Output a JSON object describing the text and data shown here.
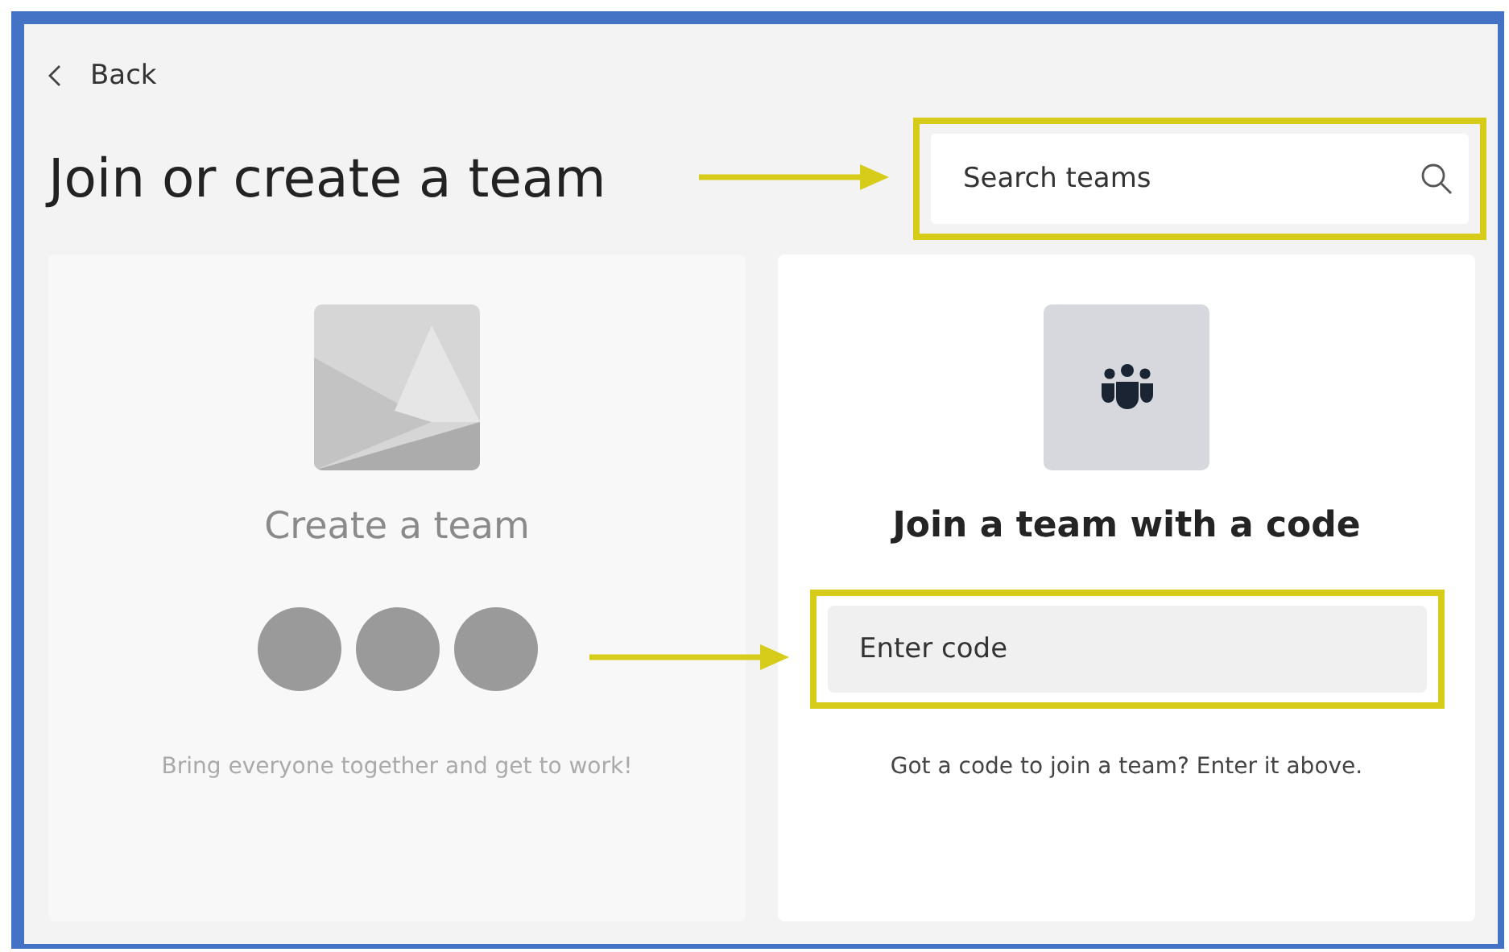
{
  "back": {
    "label": "Back"
  },
  "title": "Join or create a team",
  "search": {
    "placeholder": "Search teams"
  },
  "cards": [
    {
      "kind": "create",
      "title": "Create a team",
      "disabled": true,
      "description": "Bring everyone together and get to work!"
    },
    {
      "kind": "join",
      "title": "Join a team with a code",
      "disabled": false,
      "code_field": {
        "placeholder": "Enter code"
      },
      "description": "Got a code to join a team? Enter it above."
    }
  ]
}
